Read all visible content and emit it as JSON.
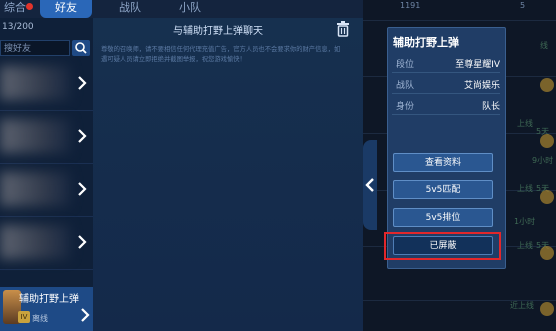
{
  "tabs": [
    {
      "label": "综合"
    },
    {
      "label": "好友"
    },
    {
      "label": "战队"
    },
    {
      "label": "小队"
    }
  ],
  "friends": {
    "count": "13/200",
    "search_placeholder": "搜好友",
    "selected": {
      "name": "辅助打野上弹",
      "status": "离线",
      "rank_badge": "IV"
    }
  },
  "chat": {
    "title": "与辅助打野上弹聊天",
    "notice": "尊敬的召唤师，请不要相信任何代理充值广告，官方人员也不会要求你的财产信息，如遇可疑人员请立即拒绝并截图举报，祝您游戏愉快！"
  },
  "background": {
    "numbers": [
      "1191",
      "5"
    ],
    "right_texts": [
      "线",
      "5天",
      "9小时",
      "5天",
      "1小时",
      "5天"
    ],
    "status_texts": [
      "上线",
      "上线",
      "上线",
      "近上线"
    ]
  },
  "card": {
    "name": "辅助打野上弹",
    "fields": [
      {
        "key": "段位",
        "value": "至尊星耀IV"
      },
      {
        "key": "战队",
        "value": "艾尚娱乐"
      },
      {
        "key": "身份",
        "value": "队长"
      }
    ],
    "buttons": {
      "view_profile": "查看资料",
      "match_5v5": "5v5匹配",
      "ranked_5v5": "5v5排位",
      "blocked": "已屏蔽"
    }
  },
  "colors": {
    "highlight": "#e2272b",
    "accent": "#2a67b8"
  }
}
